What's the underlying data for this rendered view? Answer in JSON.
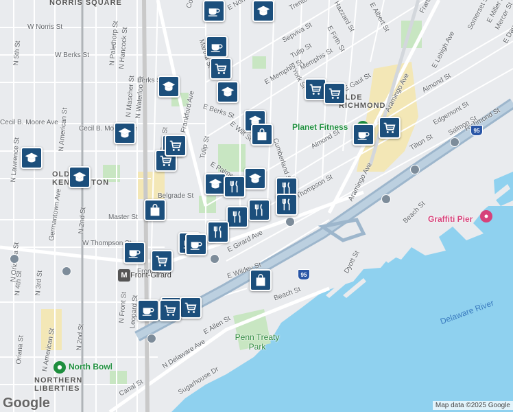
{
  "map": {
    "colors": {
      "land": "#e9ebee",
      "water": "#8fd1ef",
      "park": "#c8e6c2",
      "highway": "#9db6cc",
      "major_road": "#ffffff",
      "pin": "#1c4f7c",
      "rail": "#b0b4b8"
    },
    "neighborhoods": [
      "NORRIS SQUARE",
      "OLDE RICHMOND",
      "OLD KENSINGTON",
      "NORTHERN LIBERTIES"
    ],
    "streets": [
      "W Norris St",
      "W Berks St",
      "N 5th St",
      "Cecil B. Moore Ave",
      "Cecil B. Moore Ave",
      "N Lawrence St",
      "N American St",
      "Germantown Ave",
      "N 2nd St",
      "N Orianna St",
      "N 4th St",
      "N 3rd St",
      "Oriana St",
      "N American St",
      "N 2nd St",
      "N Palethorp St",
      "N Hancock St",
      "N Mascher St",
      "N Waterloo St",
      "Berks St",
      "N Front St",
      "Frankford Ave",
      "Tulip St",
      "E Berks St",
      "E Wilt St",
      "E Palmer St",
      "Belgrade St",
      "Master St",
      "W Thompson St",
      "Front St",
      "N Front St",
      "Leopard St",
      "E Girard Ave",
      "E Wildey St",
      "Beach St",
      "E Allen St",
      "N Delaware Ave",
      "Sugarhouse Dr",
      "Canal St",
      "Dyott St",
      "Beach St",
      "Coral St",
      "E Norris St",
      "Martha St",
      "Trenton Ave",
      "Sepviva St",
      "Tulip St",
      "Memphis St",
      "E Firth St",
      "Hazzard St",
      "E Albert St",
      "E York St",
      "E Memphis St",
      "E Gaul St",
      "Almond St",
      "Thompson St",
      "Cumberland St",
      "E Lehigh Ave",
      "Almond St",
      "Aramingo Ave",
      "Edgemont St",
      "Salmon St",
      "Tilton St",
      "Aramingo Ave",
      "Frankford Ave",
      "Somerset St",
      "E Miller St",
      "Mercer St",
      "E Dauphin St",
      "Richmond St"
    ],
    "places": [
      {
        "name": "Planet Fitness",
        "kind": "fitness"
      },
      {
        "name": "Graffiti Pier",
        "kind": "attraction"
      },
      {
        "name": "North Bowl",
        "kind": "bowling"
      },
      {
        "name": "Penn Treaty Park",
        "kind": "park"
      },
      {
        "name": "Front-Girard",
        "kind": "station"
      }
    ],
    "water_labels": [
      "Delaware River"
    ],
    "highway_labels": [
      "95",
      "95"
    ],
    "markers": [
      {
        "icon": "coffee-icon"
      },
      {
        "icon": "school-icon"
      },
      {
        "icon": "coffee-icon"
      },
      {
        "icon": "cart-icon"
      },
      {
        "icon": "school-icon"
      },
      {
        "icon": "school-icon"
      },
      {
        "icon": "cart-icon"
      },
      {
        "icon": "cart-icon"
      },
      {
        "icon": "school-icon"
      },
      {
        "icon": "school-icon"
      },
      {
        "icon": "school-icon"
      },
      {
        "icon": "bag-icon"
      },
      {
        "icon": "cart-icon"
      },
      {
        "icon": "school-icon"
      },
      {
        "icon": "school-icon"
      },
      {
        "icon": "bag-icon"
      },
      {
        "icon": "school-icon"
      },
      {
        "icon": "restaurant-icon"
      },
      {
        "icon": "restaurant-icon"
      },
      {
        "icon": "restaurant-icon"
      },
      {
        "icon": "restaurant-icon"
      },
      {
        "icon": "coffee-icon"
      },
      {
        "icon": "cart-icon"
      },
      {
        "icon": "bag-icon"
      },
      {
        "icon": "restaurant-icon"
      },
      {
        "icon": "restaurant-icon"
      },
      {
        "icon": "coffee-icon"
      },
      {
        "icon": "coffee-icon"
      },
      {
        "icon": "cart-icon"
      },
      {
        "icon": "coffee-icon"
      },
      {
        "icon": "cart-icon"
      },
      {
        "icon": "bag-icon"
      },
      {
        "icon": "cart-icon"
      },
      {
        "icon": "coffee-icon"
      },
      {
        "icon": "cart-icon"
      },
      {
        "icon": "cart-icon"
      }
    ],
    "logo": "Google",
    "attribution": "Map data ©2025 Google"
  }
}
